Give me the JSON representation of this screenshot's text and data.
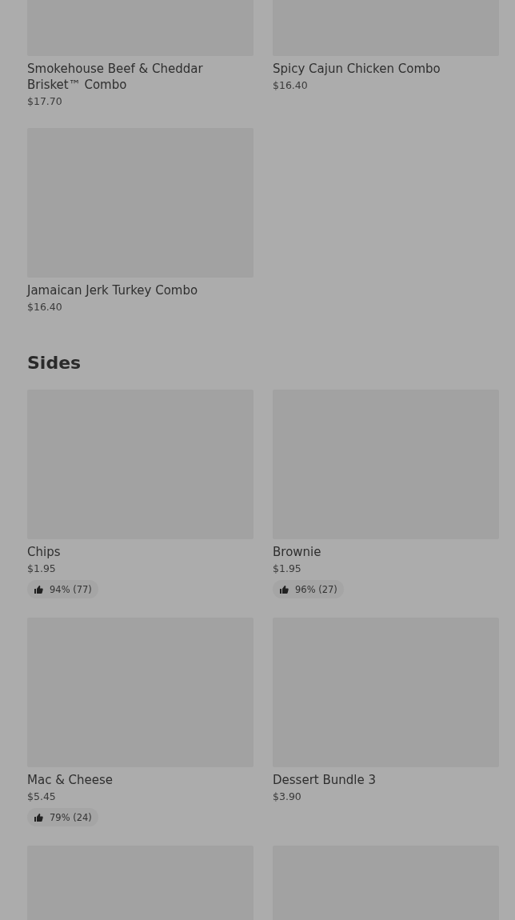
{
  "sections": [
    {
      "items": [
        {
          "kind": "item",
          "name": "Smokehouse Beef & Cheddar Brisket™ Combo",
          "price": "$17.70"
        },
        {
          "kind": "item",
          "name": "Spicy Cajun Chicken Combo",
          "price": "$16.40"
        },
        {
          "kind": "item",
          "name": "Jamaican Jerk Turkey Combo",
          "price": "$16.40"
        }
      ]
    },
    {
      "title": "Sides",
      "items": [
        {
          "kind": "item",
          "name": "Chips",
          "price": "$1.95",
          "rating": "94% (77)"
        },
        {
          "kind": "item",
          "name": "Brownie",
          "price": "$1.95",
          "rating": "96% (27)"
        },
        {
          "kind": "item",
          "name": "Mac & Cheese",
          "price": "$5.45",
          "rating": "79% (24)"
        },
        {
          "kind": "item",
          "name": "Dessert Bundle 3",
          "price": "$3.90"
        },
        {
          "kind": "picture"
        },
        {
          "kind": "picture"
        }
      ]
    }
  ]
}
